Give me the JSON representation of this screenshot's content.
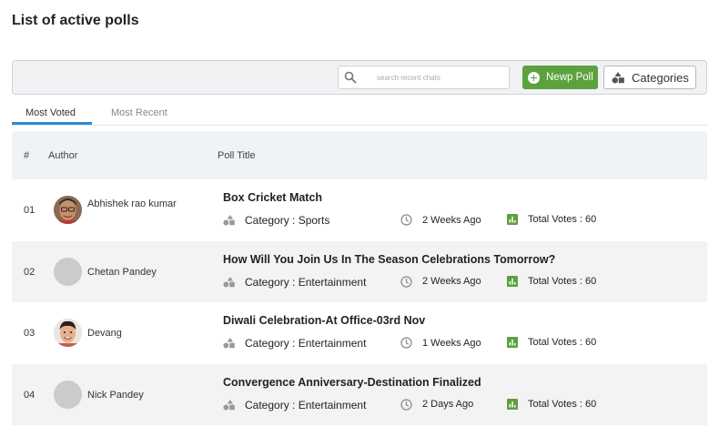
{
  "page": {
    "title": "List of active polls"
  },
  "toolbar": {
    "search_placeholder": "search recent chats",
    "new_poll_label": "Newp Poll",
    "categories_label": "Categories"
  },
  "tabs": [
    {
      "label": "Most Voted",
      "active": true
    },
    {
      "label": "Most Recent",
      "active": false
    }
  ],
  "table": {
    "headers": {
      "num": "#",
      "author": "Author",
      "title": "Poll Title"
    },
    "rows": [
      {
        "num": "01",
        "author": "Abhishek rao kumar",
        "avatar": "photo",
        "title": "Box Cricket Match",
        "category": "Category : Sports",
        "time": "2 Weeks Ago",
        "votes": "Total Votes : 60"
      },
      {
        "num": "02",
        "author": "Chetan Pandey",
        "avatar": "placeholder",
        "title": "How Will You Join Us In The Season Celebrations Tomorrow?",
        "category": "Category : Entertainment",
        "time": "2 Weeks Ago",
        "votes": "Total Votes : 60"
      },
      {
        "num": "03",
        "author": "Devang",
        "avatar": "photo",
        "title": "Diwali Celebration-At Office-03rd Nov",
        "category": "Category : Entertainment",
        "time": "1 Weeks Ago",
        "votes": "Total Votes : 60"
      },
      {
        "num": "04",
        "author": "Nick Pandey",
        "avatar": "placeholder",
        "title": "Convergence Anniversary-Destination Finalized",
        "category": "Category : Entertainment",
        "time": "2 Days Ago",
        "votes": "Total Votes : 60"
      }
    ]
  },
  "colors": {
    "accent_green": "#5ca13e",
    "tab_blue": "#2d8bd8",
    "header_bg": "#eef3f7",
    "row_alt": "#f3f3f3"
  },
  "icons": {
    "search": "search-icon",
    "plus": "plus-circle-icon",
    "categories": "shapes-icon",
    "clock": "clock-icon",
    "votes": "bar-chart-icon"
  }
}
